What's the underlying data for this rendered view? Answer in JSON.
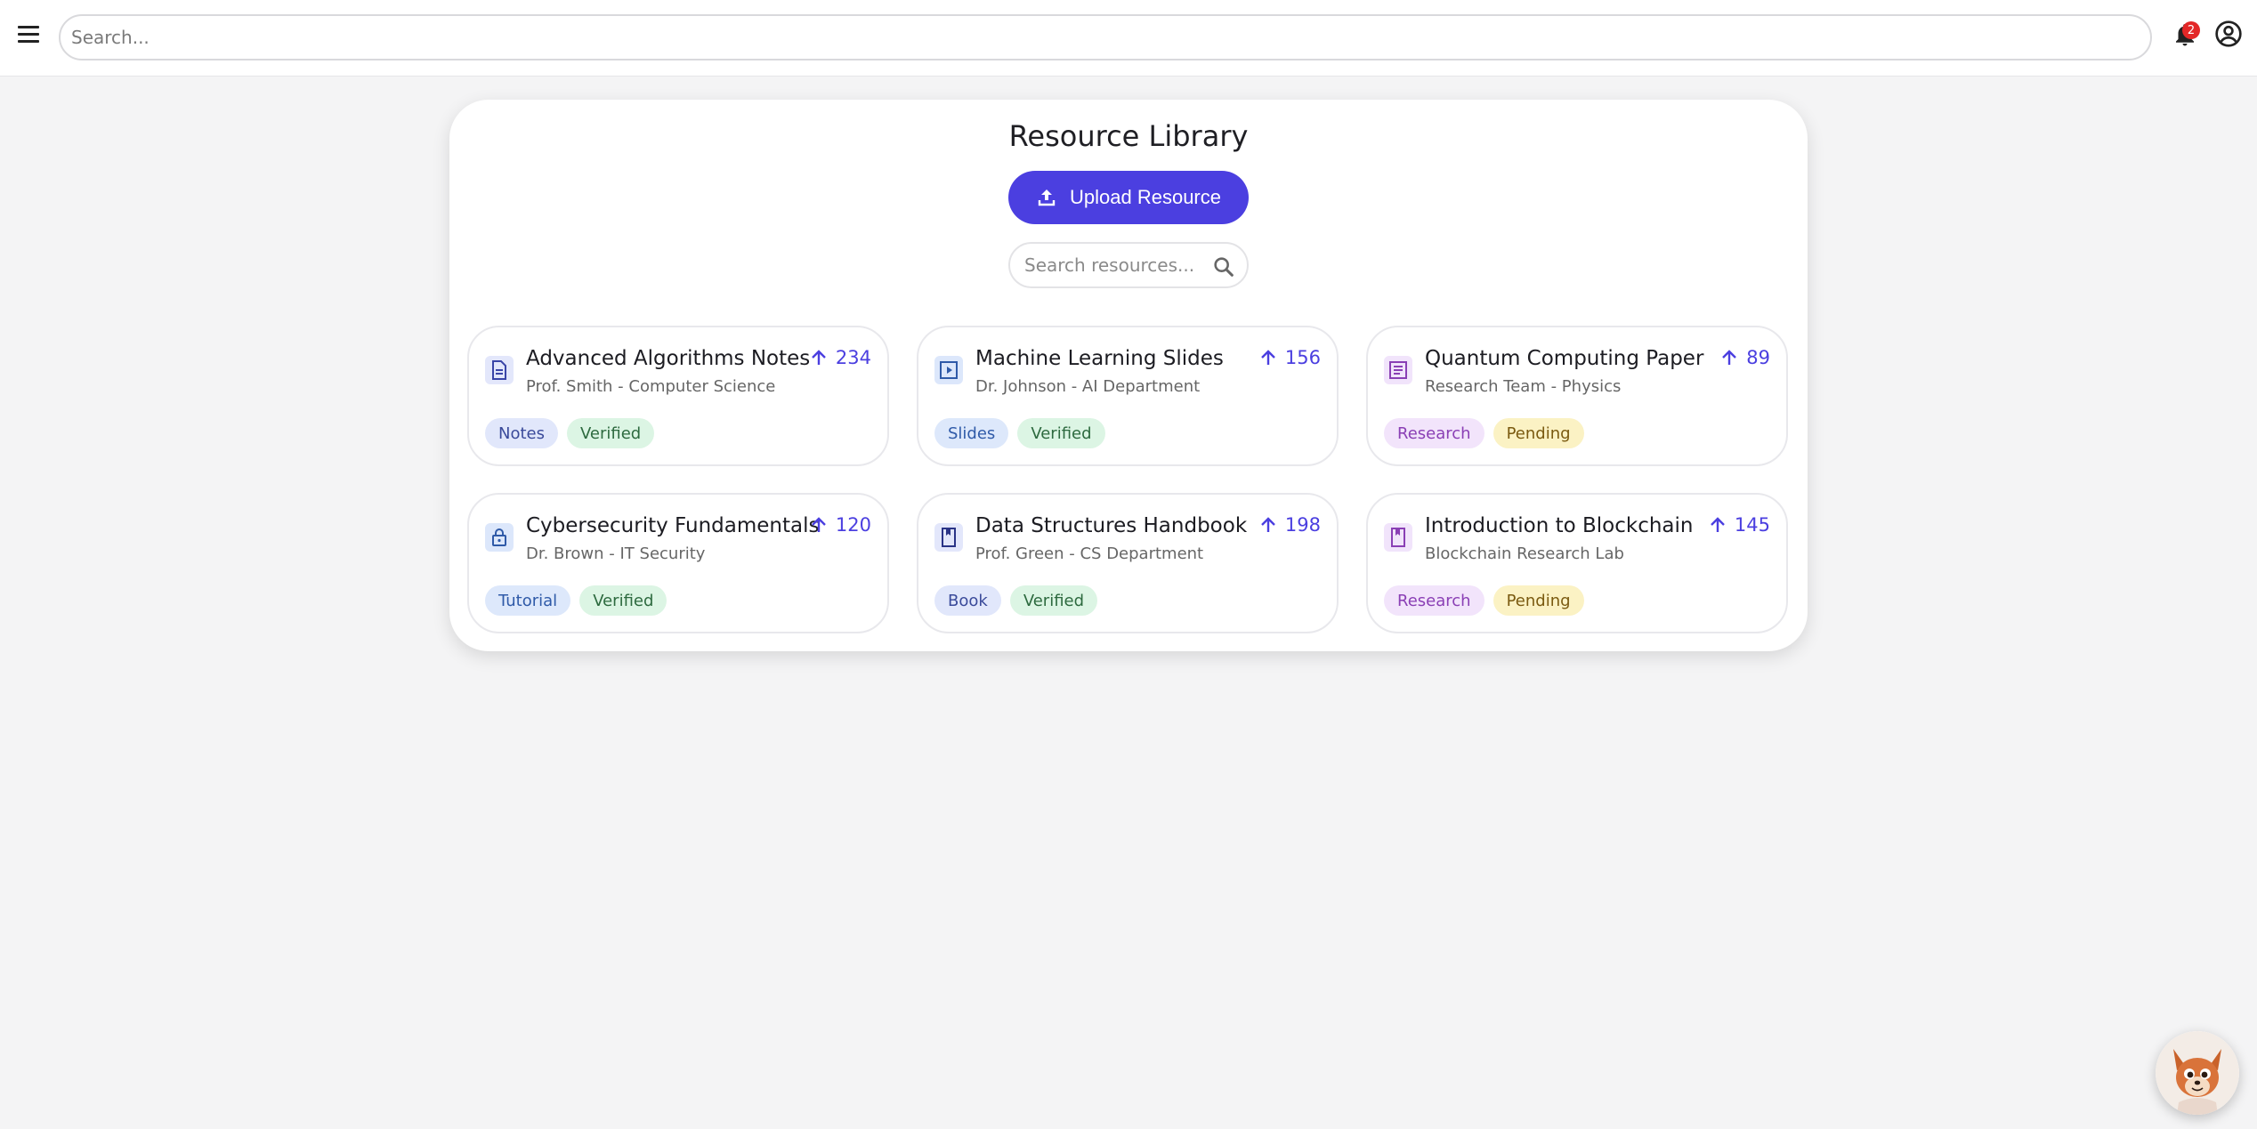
{
  "topbar": {
    "search_placeholder": "Search...",
    "notification_count": "2"
  },
  "library": {
    "title": "Resource Library",
    "upload_label": "Upload Resource",
    "search_placeholder": "Search resources..."
  },
  "cards": [
    {
      "title": "Advanced Algorithms Notes",
      "subtitle": "Prof. Smith - Computer Science",
      "votes": "234",
      "icon": "document-icon",
      "tags": [
        {
          "label": "Notes",
          "bg": "#e1e7fb",
          "fg": "#3a4a9a"
        },
        {
          "label": "Verified",
          "bg": "#dcf5e4",
          "fg": "#2d6a3f"
        }
      ]
    },
    {
      "title": "Machine Learning Slides",
      "subtitle": "Dr. Johnson - AI Department",
      "votes": "156",
      "icon": "slides-play-icon",
      "tags": [
        {
          "label": "Slides",
          "bg": "#dde8fb",
          "fg": "#2f5aa8"
        },
        {
          "label": "Verified",
          "bg": "#dcf5e4",
          "fg": "#2d6a3f"
        }
      ]
    },
    {
      "title": "Quantum Computing Paper",
      "subtitle": "Research Team - Physics",
      "votes": "89",
      "icon": "paper-icon",
      "tags": [
        {
          "label": "Research",
          "bg": "#f2e4fb",
          "fg": "#8a3fb5"
        },
        {
          "label": "Pending",
          "bg": "#fbf2c4",
          "fg": "#7a5a10"
        }
      ]
    },
    {
      "title": "Cybersecurity Fundamentals",
      "subtitle": "Dr. Brown - IT Security",
      "votes": "120",
      "icon": "lock-icon",
      "tags": [
        {
          "label": "Tutorial",
          "bg": "#dde8fb",
          "fg": "#2f5aa8"
        },
        {
          "label": "Verified",
          "bg": "#dcf5e4",
          "fg": "#2d6a3f"
        }
      ]
    },
    {
      "title": "Data Structures Handbook",
      "subtitle": "Prof. Green - CS Department",
      "votes": "198",
      "icon": "book-icon",
      "tags": [
        {
          "label": "Book",
          "bg": "#e1e7fb",
          "fg": "#3a4a9a"
        },
        {
          "label": "Verified",
          "bg": "#dcf5e4",
          "fg": "#2d6a3f"
        }
      ]
    },
    {
      "title": "Introduction to Blockchain",
      "subtitle": "Blockchain Research Lab",
      "votes": "145",
      "icon": "book-icon",
      "tags": [
        {
          "label": "Research",
          "bg": "#f2e4fb",
          "fg": "#8a3fb5"
        },
        {
          "label": "Pending",
          "bg": "#fbf2c4",
          "fg": "#7a5a10"
        }
      ]
    }
  ],
  "colors": {
    "accent": "#4b3fe0",
    "badge": "#e32727"
  }
}
